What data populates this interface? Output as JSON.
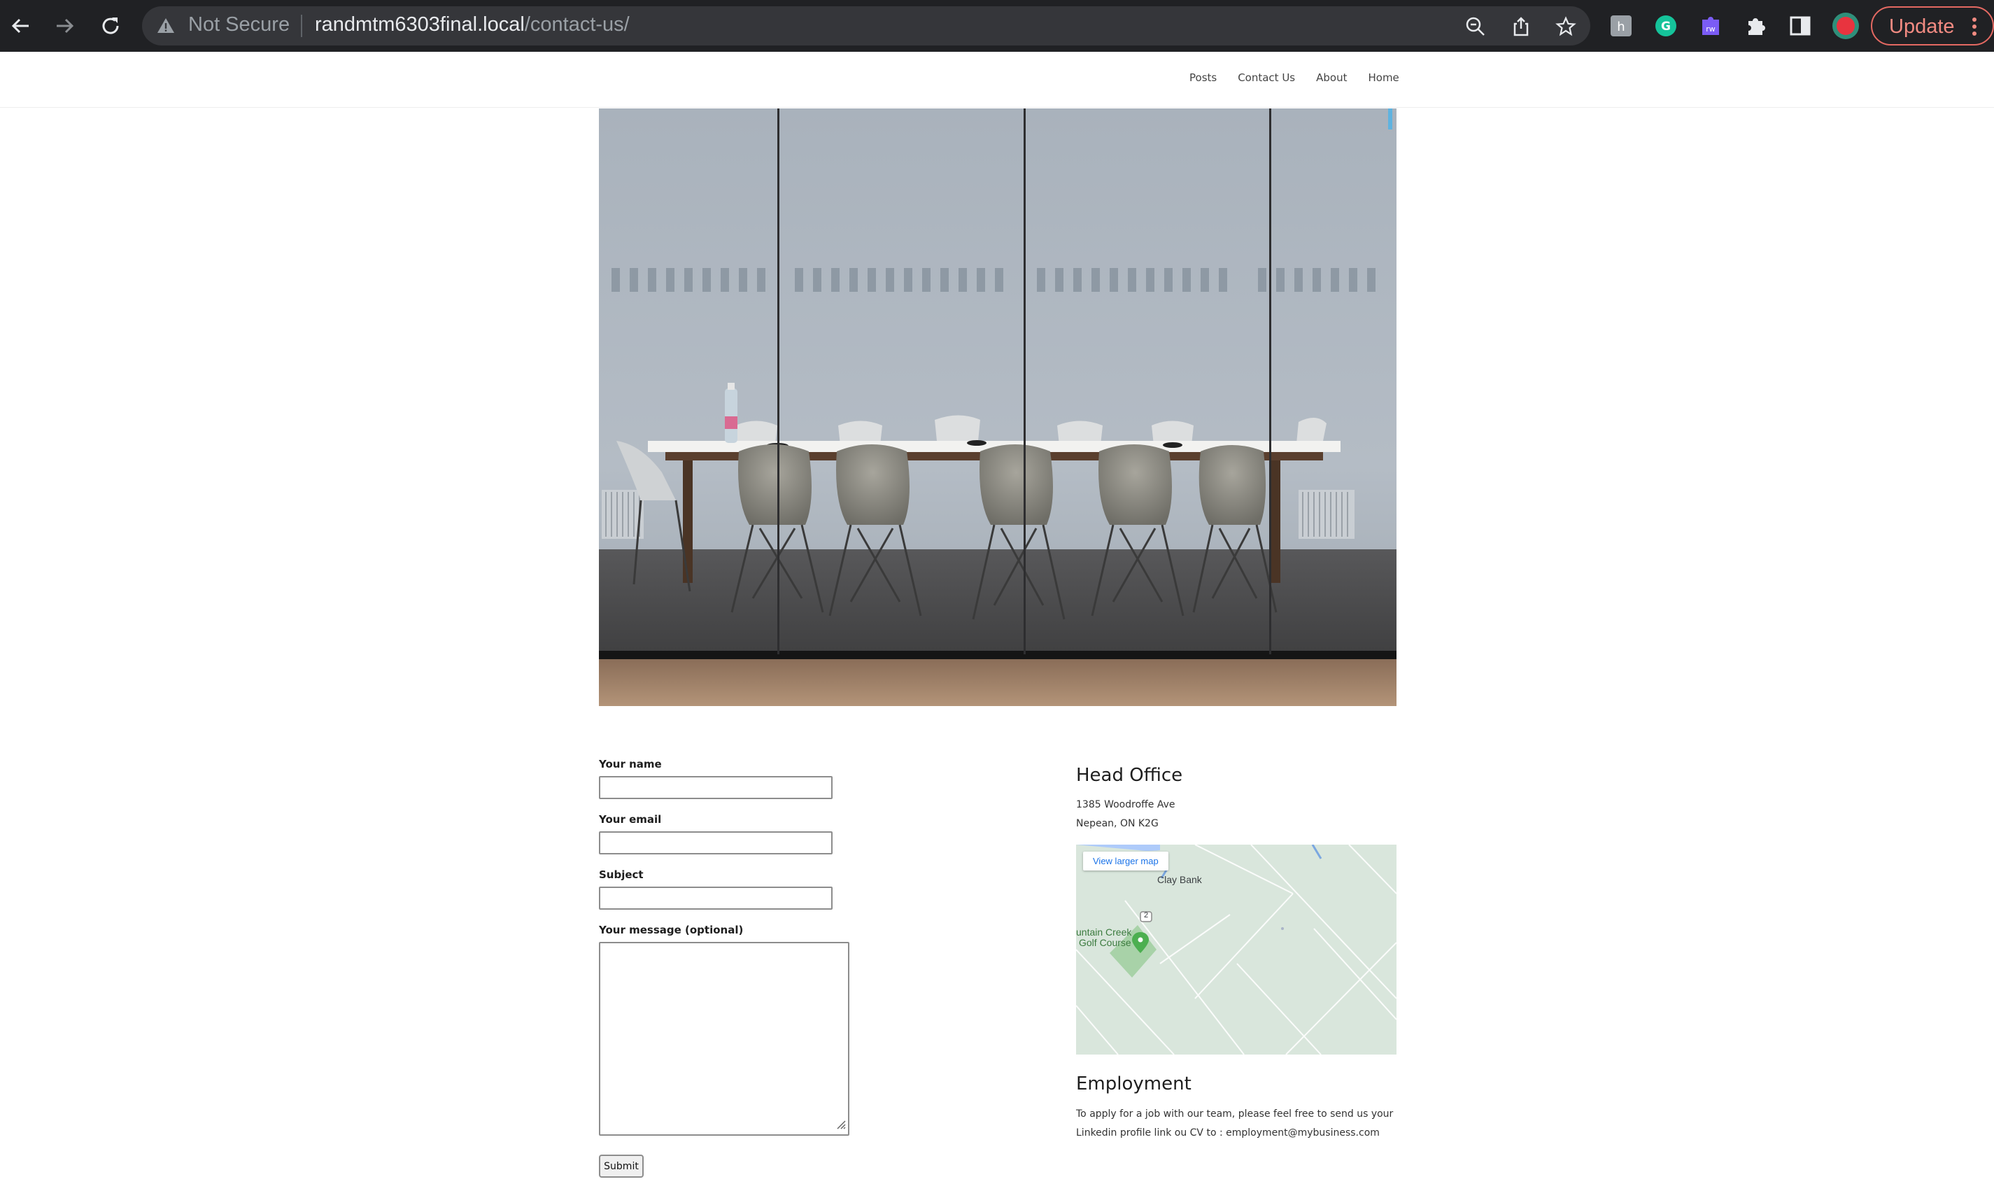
{
  "browser": {
    "security_label": "Not Secure",
    "url_host": "randmtm6303final.local",
    "url_path": "/contact-us/",
    "update_label": "Update",
    "toolbar_icons": [
      "back-icon",
      "forward-icon",
      "reload-icon",
      "zoom-icon",
      "share-icon",
      "bookmark-star-icon",
      "extension-h-icon",
      "grammarly-icon",
      "extension-rw-icon",
      "puzzle-extensions-icon",
      "sidepanel-icon",
      "profile-avatar"
    ]
  },
  "nav": {
    "items": [
      "Posts",
      "Contact Us",
      "About",
      "Home"
    ]
  },
  "hero": {
    "icon": "conference-room-photo"
  },
  "form": {
    "name_label": "Your name",
    "email_label": "Your email",
    "subject_label": "Subject",
    "message_label": "Your message (optional)",
    "name_value": "",
    "email_value": "",
    "subject_value": "",
    "message_value": "",
    "submit_label": "Submit"
  },
  "office": {
    "heading": "Head Office",
    "address_line1": "1385 Woodroffe Ave",
    "address_line2": "Nepean, ON K2G",
    "map": {
      "button": "View larger map",
      "place_label": "Clay Bank",
      "golf_line1": "untain Creek",
      "golf_line2": "Golf Course",
      "road_number": "2"
    }
  },
  "employment": {
    "heading": "Employment",
    "text": "To apply for a job with our team, please feel free to send us your Linkedin profile link ou CV to : employment@mybusiness.com"
  },
  "colors": {
    "chrome_bg": "#202124",
    "omnibox_bg": "#35363a",
    "update_accent": "#f28b82",
    "map_bg": "#d9e6dc",
    "map_link": "#1a73e8"
  }
}
